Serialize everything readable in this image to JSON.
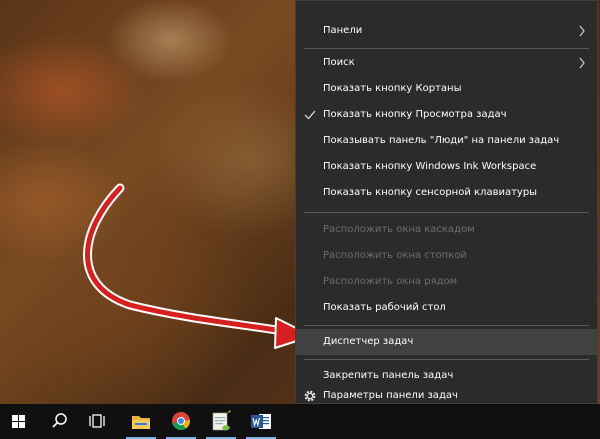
{
  "context_menu": {
    "items": [
      {
        "label": "Панели",
        "submenu": true
      },
      {
        "label": "Поиск",
        "submenu": true
      },
      {
        "label": "Показать кнопку Кортаны"
      },
      {
        "label": "Показать кнопку Просмотра задач",
        "checked": true
      },
      {
        "label": "Показывать панель \"Люди\" на панели задач"
      },
      {
        "label": "Показать кнопку Windows Ink Workspace"
      },
      {
        "label": "Показать кнопку сенсорной клавиатуры"
      },
      {
        "label": "Расположить окна каскадом",
        "disabled": true
      },
      {
        "label": "Расположить окна стопкой",
        "disabled": true
      },
      {
        "label": "Расположить окна рядом",
        "disabled": true
      },
      {
        "label": "Показать рабочий стол"
      },
      {
        "label": "Диспетчер задач",
        "highlighted": true
      },
      {
        "label": "Закрепить панель задач"
      },
      {
        "label": "Параметры панели задач",
        "icon": "gear-icon"
      }
    ]
  },
  "taskbar": {
    "items": [
      {
        "name": "start-button",
        "icon": "windows-logo-icon"
      },
      {
        "name": "search-button",
        "icon": "search-icon"
      },
      {
        "name": "task-view-button",
        "icon": "task-view-icon"
      },
      {
        "name": "file-explorer-button",
        "icon": "folder-icon"
      },
      {
        "name": "chrome-button",
        "icon": "chrome-icon"
      },
      {
        "name": "notepad-plus-button",
        "icon": "notepad-plus-icon"
      },
      {
        "name": "word-button",
        "icon": "word-icon"
      }
    ]
  },
  "colors": {
    "menu_bg": "#2b2b2b",
    "menu_highlight": "#414141",
    "taskbar_bg": "#101010",
    "arrow": "#d81f1f"
  }
}
